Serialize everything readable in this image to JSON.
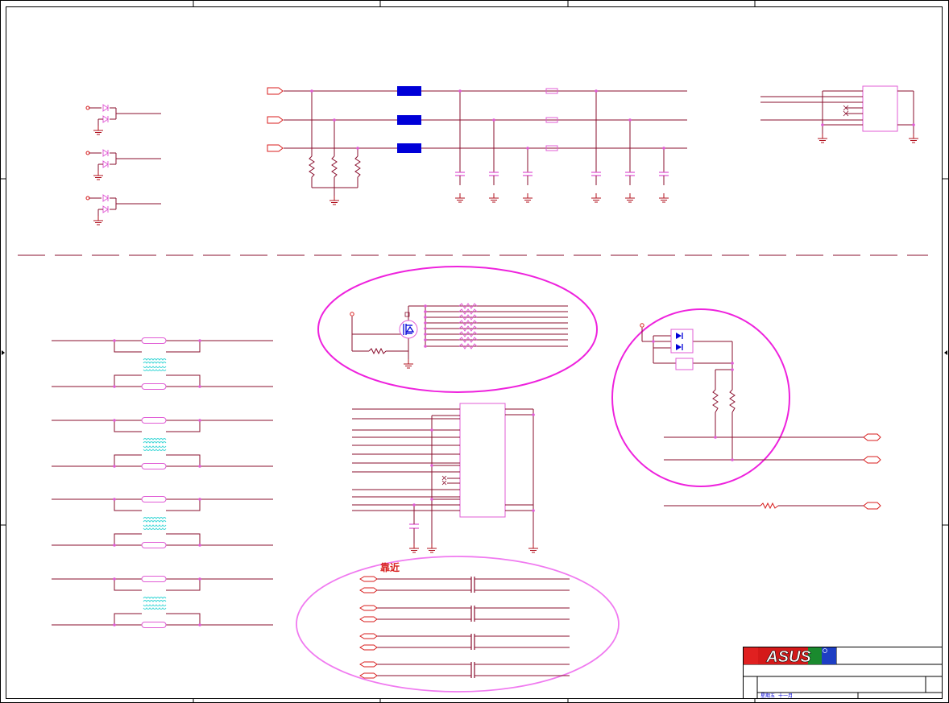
{
  "annotation": {
    "near_label": "靠近"
  },
  "title_block": {
    "brand": "ASUS",
    "date_label": "星期五",
    "date_value": "十一月"
  },
  "colors": {
    "border": "#000000",
    "wire": "#8a0f2e",
    "component": "#e05cd5",
    "highlight_circle": "#ee22dd",
    "circle_soft": "#f07af0",
    "ferrite": "#0000d8",
    "ground": "#b0101e",
    "transformer": "#39d6d6",
    "net_flag": "#d81e1e",
    "note_text": "#d81e1e",
    "brand_bg": "#d41919"
  }
}
